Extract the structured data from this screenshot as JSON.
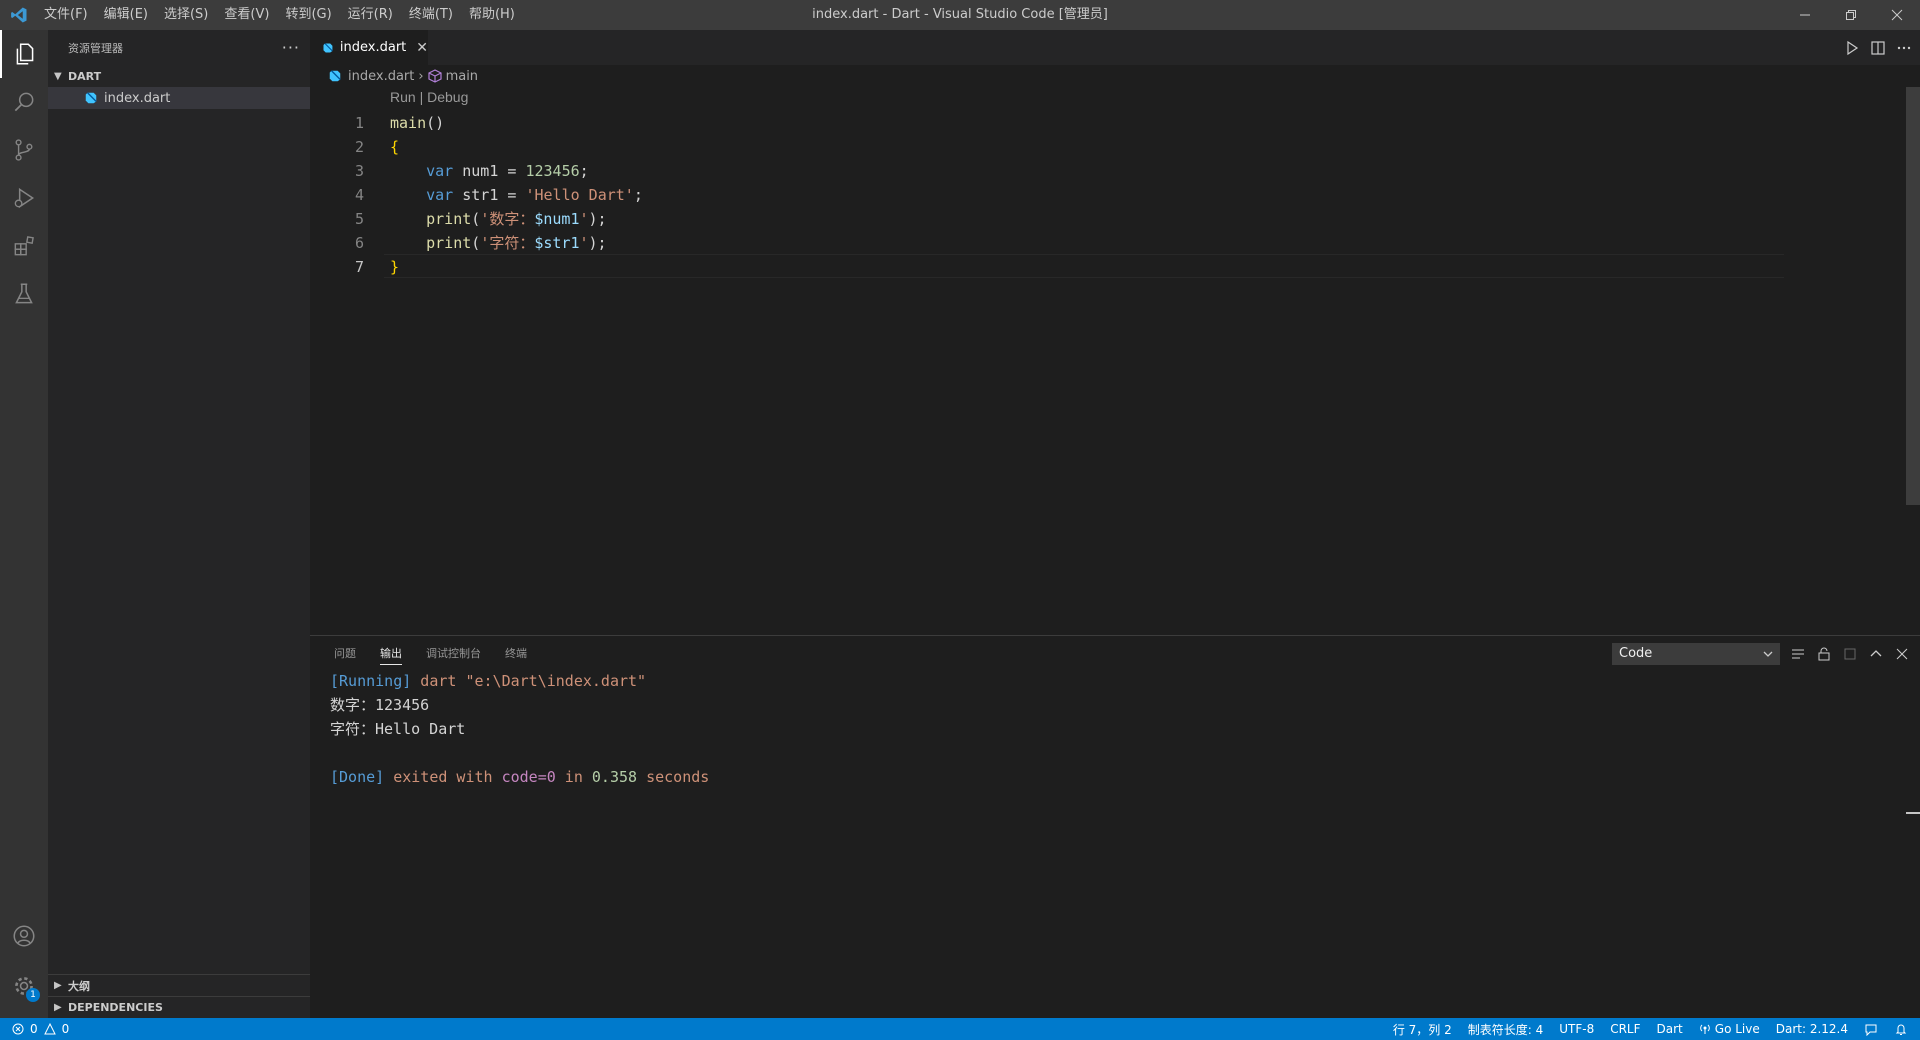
{
  "window": {
    "title": "index.dart - Dart - Visual Studio Code [管理员]"
  },
  "menu": [
    "文件(F)",
    "编辑(E)",
    "选择(S)",
    "查看(V)",
    "转到(G)",
    "运行(R)",
    "终端(T)",
    "帮助(H)"
  ],
  "sidebar": {
    "title": "资源管理器",
    "more": "···",
    "folder": "DART",
    "files": [
      "index.dart"
    ],
    "sections": [
      "大纲",
      "DEPENDENCIES"
    ]
  },
  "activity_bar": {
    "icons": [
      "explorer-icon",
      "search-icon",
      "source-control-icon",
      "run-debug-icon",
      "extensions-icon",
      "testing-icon",
      "account-icon",
      "settings-gear-icon"
    ],
    "settings_badge": "1"
  },
  "tabs": [
    {
      "label": "index.dart",
      "active": true
    }
  ],
  "breadcrumb": {
    "file": "index.dart",
    "symbol": "main"
  },
  "editor": {
    "codelens": "Run | Debug",
    "line_numbers": [
      "1",
      "2",
      "3",
      "4",
      "5",
      "6",
      "7"
    ],
    "current_line": 7,
    "lines": [
      "main()",
      "{",
      "    var num1 = 123456;",
      "    var str1 = 'Hello Dart';",
      "    print('数字：$num1');",
      "    print('字符：$str1');",
      "}"
    ]
  },
  "panel": {
    "tabs": [
      "问题",
      "输出",
      "调试控制台",
      "终端"
    ],
    "active_tab": "输出",
    "output_channel": "Code",
    "output_lines": [
      "[Running] dart \"e:\\Dart\\index.dart\"",
      "数字：123456",
      "字符：Hello Dart",
      "",
      "[Done] exited with code=0 in 0.358 seconds"
    ]
  },
  "status": {
    "errors": "0",
    "warnings": "0",
    "position": "行 7，列 2",
    "indent": "制表符长度: 4",
    "encoding": "UTF-8",
    "eol": "CRLF",
    "language": "Dart",
    "golive": "Go Live",
    "sdk": "Dart: 2.12.4"
  },
  "colors": {
    "accent": "#007acc",
    "titlebar": "#3c3c3c",
    "sidebar": "#252526",
    "editor": "#1e1e1e",
    "activitybar": "#333333"
  }
}
